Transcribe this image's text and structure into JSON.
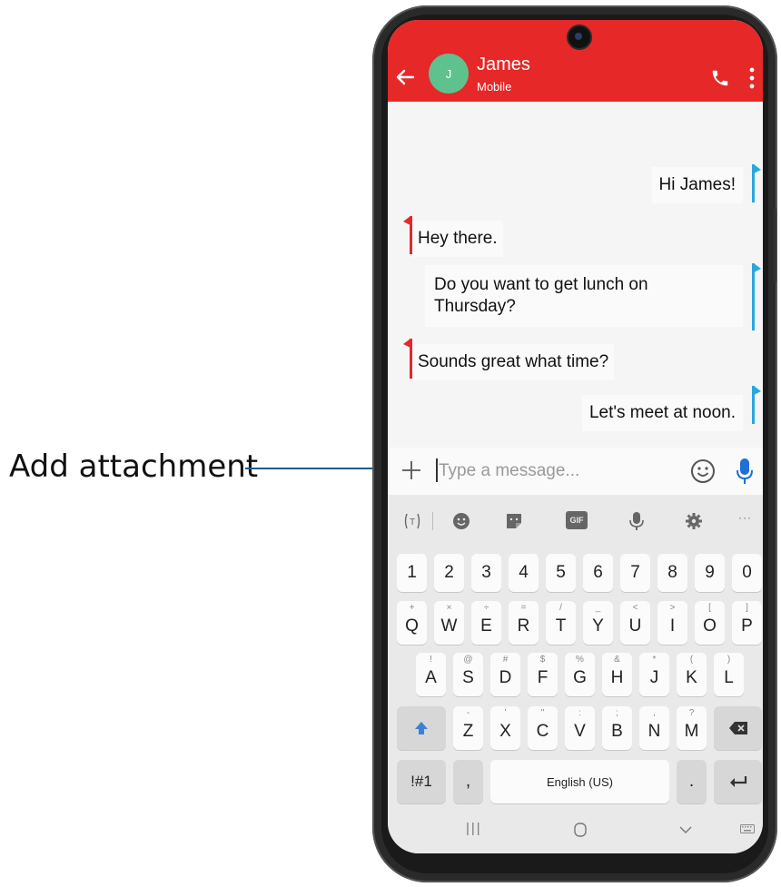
{
  "callout": {
    "label": "Add attachment"
  },
  "header": {
    "avatar_initial": "J",
    "contact_name": "James",
    "contact_type": "Mobile",
    "bg_color": "#e62828"
  },
  "messages": [
    {
      "dir": "out",
      "text": "Hi James!"
    },
    {
      "dir": "in",
      "text": "Hey there."
    },
    {
      "dir": "out",
      "text_line1": "Do you want to get lunch on",
      "text_line2": "Thursday?"
    },
    {
      "dir": "in",
      "text": "Sounds great what time?"
    },
    {
      "dir": "out",
      "text": "Let's meet at noon."
    }
  ],
  "compose": {
    "placeholder": "Type a message..."
  },
  "keyboard": {
    "toolbar_icons": [
      "translate-icon",
      "emoji-icon",
      "sticker-icon",
      "gif-icon",
      "voice-input-icon",
      "settings-icon",
      "more-icon"
    ],
    "gif_label": "GIF",
    "more_label": "···",
    "number_row": [
      "1",
      "2",
      "3",
      "4",
      "5",
      "6",
      "7",
      "8",
      "9",
      "0"
    ],
    "row1": {
      "keys": [
        "Q",
        "W",
        "E",
        "R",
        "T",
        "Y",
        "U",
        "I",
        "O",
        "P"
      ],
      "subs": [
        "+",
        "×",
        "÷",
        "=",
        "/",
        "_",
        "<",
        ">",
        "[",
        "]"
      ]
    },
    "row2": {
      "keys": [
        "A",
        "S",
        "D",
        "F",
        "G",
        "H",
        "J",
        "K",
        "L"
      ],
      "subs": [
        "!",
        "@",
        "#",
        "$",
        "%",
        "&",
        "*",
        "(",
        ")"
      ]
    },
    "row3": {
      "keys": [
        "Z",
        "X",
        "C",
        "V",
        "B",
        "N",
        "M"
      ],
      "subs": [
        "-",
        "'",
        "\"",
        ":",
        ";",
        ",",
        "?"
      ]
    },
    "symbols_label": "!#1",
    "comma_label": ",",
    "space_label": "English (US)",
    "period_label": ".",
    "nav": {
      "recents_label": "|||"
    }
  },
  "colors": {
    "outgoing_tail": "#2aa6e0",
    "incoming_tail": "#e62828",
    "mic": "#1e6fd6"
  }
}
